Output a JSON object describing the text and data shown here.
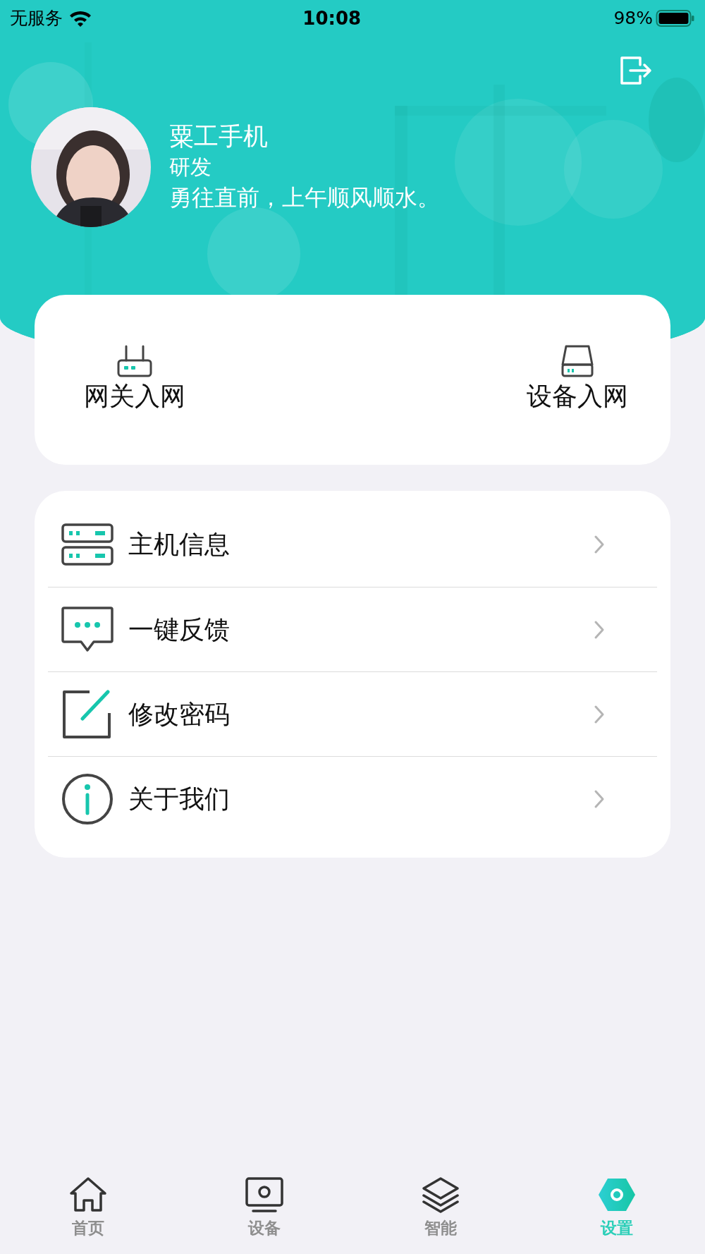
{
  "status_bar": {
    "carrier": "无服务",
    "time": "10:08",
    "battery": "98%"
  },
  "profile": {
    "name": "粟工手机",
    "role": "研发",
    "motto": "勇往直前，上午顺风顺水。"
  },
  "quick_actions": [
    {
      "kind": "gateway",
      "label": "网关入网"
    },
    {
      "kind": "device",
      "label": "设备入网"
    }
  ],
  "menu": [
    {
      "kind": "server",
      "label": "主机信息"
    },
    {
      "kind": "feedback",
      "label": "一键反馈"
    },
    {
      "kind": "edit",
      "label": "修改密码"
    },
    {
      "kind": "info",
      "label": "关于我们"
    }
  ],
  "tabs": [
    {
      "kind": "home",
      "label": "首页",
      "selected": false
    },
    {
      "kind": "device",
      "label": "设备",
      "selected": false
    },
    {
      "kind": "layers",
      "label": "智能",
      "selected": false
    },
    {
      "kind": "settings",
      "label": "设置",
      "selected": true
    }
  ]
}
